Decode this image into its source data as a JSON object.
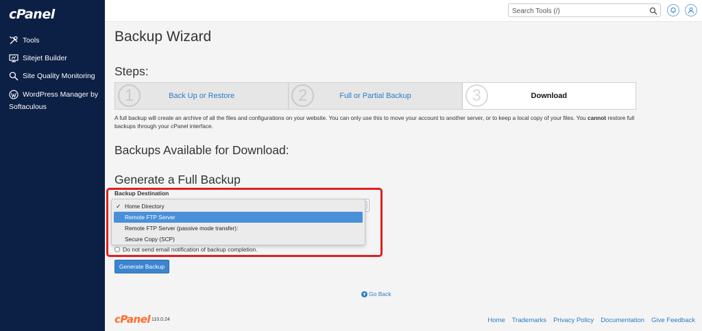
{
  "sidebar": {
    "logo": "cPanel",
    "items": [
      {
        "label": "Tools",
        "icon": "tools-icon"
      },
      {
        "label": "Sitejet Builder",
        "icon": "sitejet-icon"
      },
      {
        "label": "Site Quality Monitoring",
        "icon": "site-quality-icon"
      },
      {
        "label": "WordPress Manager by",
        "label2": "Softaculous",
        "icon": "wordpress-icon"
      }
    ]
  },
  "topbar": {
    "search_placeholder": "Search Tools (/)",
    "icons": [
      "search-icon",
      "bell-icon",
      "user-icon"
    ]
  },
  "main": {
    "title": "Backup Wizard",
    "steps_heading": "Steps:",
    "steps": [
      {
        "num": "1",
        "label": "Back Up or Restore"
      },
      {
        "num": "2",
        "label": "Full or Partial Backup"
      },
      {
        "num": "3",
        "label": "Download"
      }
    ],
    "description_part1": "A full backup will create an archive of all the files and configurations on your website. You can only use this to move your account to another server, or to keep a local copy of your files. You",
    "description_bold": "cannot",
    "description_part2": "restore full backups through your cPanel interface.",
    "available_heading": "Backups Available for Download:",
    "generate_heading": "Generate a Full Backup",
    "destination_label": "Backup Destination",
    "destination_options": [
      "Home Directory",
      "Remote FTP Server",
      "Remote FTP Server (passive mode transfer):",
      "Secure Copy (SCP)"
    ],
    "checked_option": "Home Directory",
    "highlighted_option": "Remote FTP Server",
    "no_email_label": "Do not send email notification of backup completion.",
    "generate_button": "Generate Backup",
    "go_back": "Go Back"
  },
  "footer": {
    "brand": "cPanel",
    "version": "110.0.24",
    "links": [
      "Home",
      "Trademarks",
      "Privacy Policy",
      "Documentation",
      "Give Feedback"
    ]
  },
  "colors": {
    "sidebar_bg": "#0c1f44",
    "accent": "#2b7bc5",
    "button": "#3b84cf",
    "highlight_red": "#e01e1e",
    "brand_orange": "#ff6c2c",
    "selected_option": "#4a90d9"
  }
}
